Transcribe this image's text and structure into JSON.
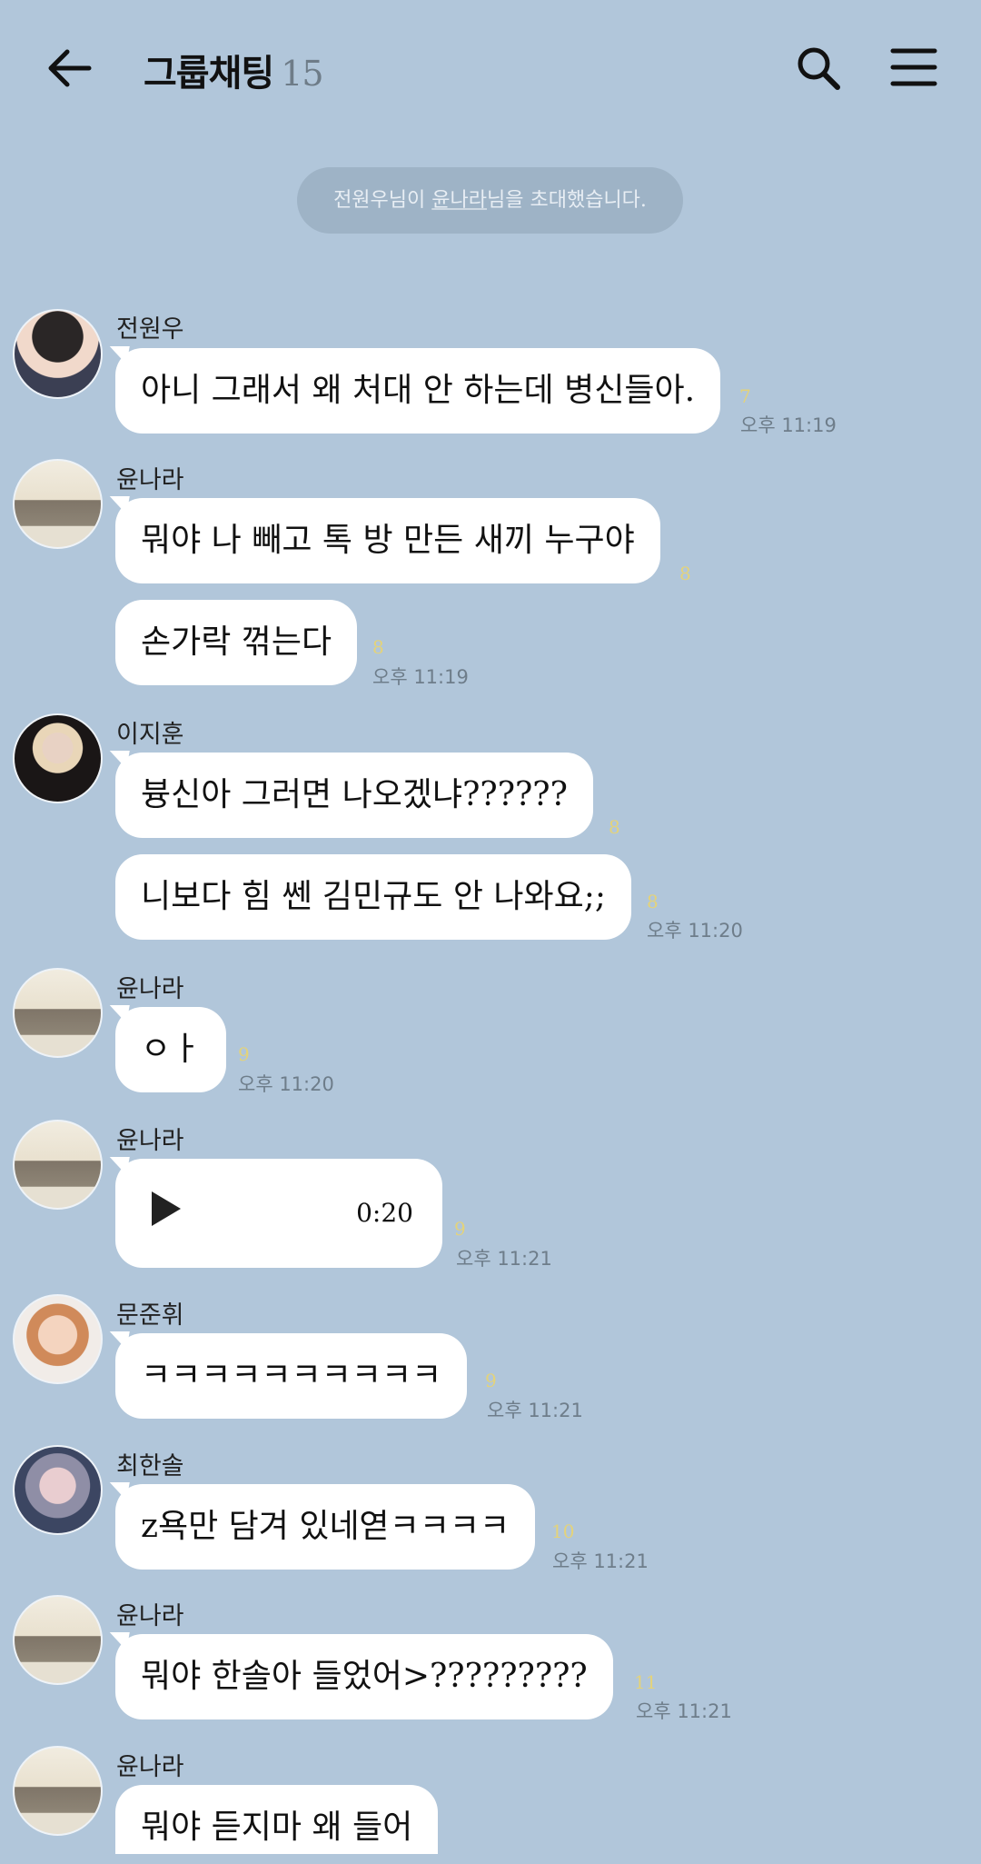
{
  "header": {
    "title": "그룹채팅",
    "member_count": "15"
  },
  "notice": {
    "pre": "전원우님이 ",
    "invitee": "윤나라",
    "post": "님을 초대했습니다."
  },
  "messages": [
    {
      "sender": "전원우",
      "text": "아니 그래서 왜 처대 안 하는데 병신들아.",
      "unread": "7",
      "time": "오후 11:19"
    },
    {
      "sender": "윤나라",
      "text": "뭐야 나 빼고 톡 방 만든 새끼 누구야",
      "unread": "8"
    },
    {
      "text": "손가락 꺾는다",
      "unread": "8",
      "time": "오후 11:19"
    },
    {
      "sender": "이지훈",
      "text": "븅신아 그러면 나오겠냐??????",
      "unread": "8"
    },
    {
      "text": "니보다 힘 쎈 김민규도 안 나와요;;",
      "unread": "8",
      "time": "오후 11:20"
    },
    {
      "sender": "윤나라",
      "text": "ㅇㅏ",
      "unread": "9",
      "time": "오후 11:20"
    },
    {
      "sender": "윤나라",
      "voice_duration": "0:20",
      "unread": "9",
      "time": "오후 11:21"
    },
    {
      "sender": "문준휘",
      "text": "ㅋㅋㅋㅋㅋㅋㅋㅋㅋㅋ",
      "unread": "9",
      "time": "오후 11:21"
    },
    {
      "sender": "최한솔",
      "text": "z욕만 담겨 있네엳ㅋㅋㅋㅋ",
      "unread": "10",
      "time": "오후 11:21"
    },
    {
      "sender": "윤나라",
      "text": "뭐야 한솔아 들었어>?????????",
      "unread": "11",
      "time": "오후 11:21"
    },
    {
      "sender": "윤나라",
      "text": "뭐야 듣지마 왜 들어"
    }
  ],
  "icons": {
    "back": "arrow-left-icon",
    "search": "search-icon",
    "menu": "hamburger-menu-icon",
    "play": "play-icon"
  }
}
